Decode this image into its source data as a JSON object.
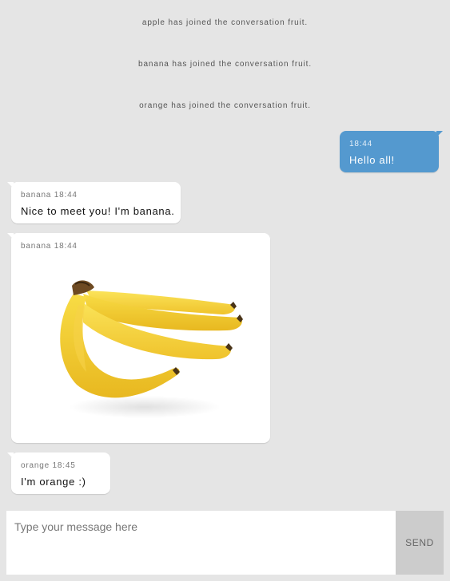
{
  "system_messages": [
    "apple has joined the conversation fruit.",
    "banana has joined the conversation fruit.",
    "orange has joined the conversation fruit."
  ],
  "messages": [
    {
      "sender": "",
      "time": "18:44",
      "text": "Hello all!",
      "side": "right"
    },
    {
      "sender": "banana",
      "time": "18:44",
      "text": "Nice to meet you! I'm banana.",
      "side": "left"
    },
    {
      "sender": "banana",
      "time": "18:44",
      "image": "banana-image",
      "side": "left"
    },
    {
      "sender": "orange",
      "time": "18:45",
      "text": "I'm orange :)",
      "side": "left"
    }
  ],
  "composer": {
    "placeholder": "Type your message here",
    "send_label": "SEND"
  },
  "colors": {
    "background": "#e5e5e5",
    "own_bubble": "#5499cf",
    "other_bubble": "#ffffff",
    "send_button": "#cccccc"
  }
}
